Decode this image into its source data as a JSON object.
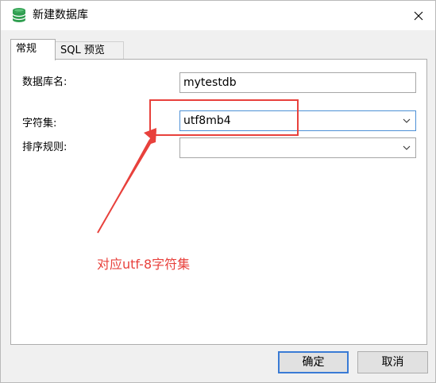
{
  "window": {
    "title": "新建数据库",
    "close_glyph": "✕"
  },
  "tabs": [
    {
      "label": "常规",
      "active": true
    },
    {
      "label": "SQL 预览",
      "active": false
    }
  ],
  "form": {
    "db_name_label": "数据库名:",
    "db_name_value": "mytestdb",
    "charset_label": "字符集:",
    "charset_value": "utf8mb4",
    "collation_label": "排序规则:",
    "collation_value": ""
  },
  "annotation": {
    "text": "对应utf-8字符集",
    "color": "#e8413c"
  },
  "buttons": {
    "ok_label": "确定",
    "cancel_label": "取消"
  },
  "colors": {
    "accent": "#3a7bd5",
    "icon_green": "#2e9e4f",
    "annotation_red": "#e8413c"
  },
  "icons": {
    "app": "database-icon",
    "close": "close-icon",
    "dropdown": "chevron-down-icon"
  }
}
